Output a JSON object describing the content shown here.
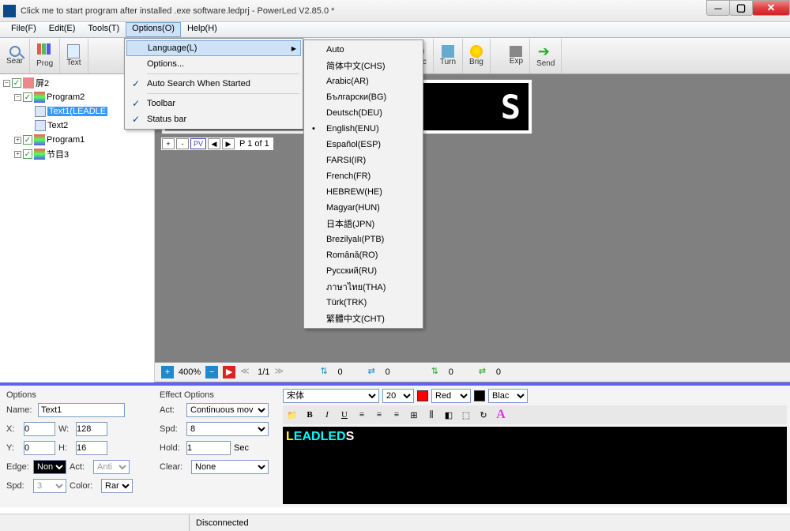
{
  "window": {
    "title": "Click me to start program after installed .exe software.ledprj - PowerLed V2.85.0 *"
  },
  "menubar": {
    "file": "File(F)",
    "edit": "Edit(E)",
    "tools": "Tools(T)",
    "options": "Options(O)",
    "help": "Help(H)"
  },
  "toolbar": {
    "sear": "Sear",
    "prog": "Prog",
    "text": "Text",
    "sync": "Sync",
    "turn": "Turn",
    "brig": "Brig",
    "exp": "Exp",
    "send": "Send"
  },
  "dropdown_options": {
    "language": "Language(L)",
    "options": "Options...",
    "autosearch": "Auto Search When Started",
    "toolbar": "Toolbar",
    "statusbar": "Status bar"
  },
  "languages": [
    "Auto",
    "简体中文(CHS)",
    "Arabic(AR)",
    "Български(BG)",
    "Deutsch(DEU)",
    "English(ENU)",
    "Español(ESP)",
    "FARSI(IR)",
    "French(FR)",
    "HEBREW(HE)",
    "Magyar(HUN)",
    "日本語(JPN)",
    "Brezilyalı(PTB)",
    "Română(RO)",
    "Русский(RU)",
    "ภาษาไทย(THA)",
    "Türk(TRK)",
    "繁體中文(CHT)"
  ],
  "tree": {
    "root": "屏2",
    "prog2": "Program2",
    "text1": "Text1(LEADLE",
    "text2": "Text2",
    "prog1": "Program1",
    "item3": "节目3"
  },
  "pagebar": {
    "plus": "+",
    "minus": "-",
    "pv": "PV",
    "left": "◀",
    "right": "▶",
    "info": "P 1 of 1"
  },
  "statusbar": {
    "zoom": "400%",
    "frame": "1/1",
    "v0a": "0",
    "v0b": "0",
    "v0c": "0",
    "v0d": "0"
  },
  "panel": {
    "options_title": "Options",
    "effect_title": "Effect Options",
    "name_lbl": "Name:",
    "name_val": "Text1",
    "x_lbl": "X:",
    "x_val": "0",
    "w_lbl": "W:",
    "w_val": "128",
    "y_lbl": "Y:",
    "y_val": "0",
    "h_lbl": "H:",
    "h_val": "16",
    "edge_lbl": "Edge:",
    "edge_val": "Non",
    "act2_lbl": "Act:",
    "act2_val": "Anti",
    "spd_lbl": "Spd:",
    "spd_val": "3",
    "color_lbl": "Color:",
    "color_val": "Rand",
    "act_lbl": "Act:",
    "act_val": "Continuous mov",
    "espd_lbl": "Spd:",
    "espd_val": "8",
    "hold_lbl": "Hold:",
    "hold_val": "1",
    "sec": "Sec",
    "clear_lbl": "Clear:",
    "clear_val": "None",
    "font": "宋体",
    "size": "20",
    "red": "Red",
    "black": "Blac"
  },
  "ledtext": {
    "l": "L",
    "e": "E",
    "a": "A",
    "d": "D",
    "l2": "L",
    "e2": "E",
    "d2": "D",
    "s": "S"
  },
  "footer": {
    "status": "Disconnected"
  }
}
